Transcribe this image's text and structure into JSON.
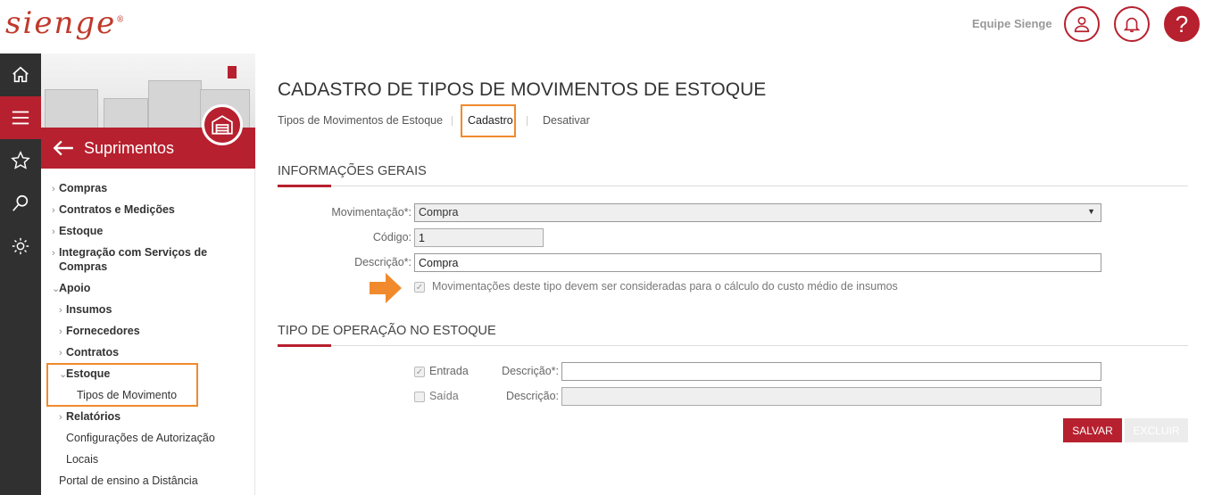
{
  "header": {
    "logo": "sienge",
    "logo_mark": "®",
    "team_label": "Equipe Sienge",
    "icons": [
      "user-icon",
      "bell-icon",
      "help-icon"
    ],
    "help_glyph": "?"
  },
  "rail": {
    "icons": [
      "home-icon",
      "menu-icon",
      "star-icon",
      "search-icon",
      "settings-icon"
    ]
  },
  "sidebar": {
    "module_title": "Suprimentos",
    "items": [
      {
        "label": "Compras"
      },
      {
        "label": "Contratos e Medições"
      },
      {
        "label": "Estoque"
      },
      {
        "label": "Integração com Serviços de"
      },
      {
        "label": "Compras"
      },
      {
        "label": "Apoio"
      },
      {
        "label": "Insumos"
      },
      {
        "label": "Fornecedores"
      },
      {
        "label": "Contratos"
      },
      {
        "label": "Estoque"
      },
      {
        "label": "Tipos de Movimento"
      },
      {
        "label": "Relatórios"
      },
      {
        "label": "Configurações de Autorização"
      },
      {
        "label": "Locais"
      },
      {
        "label": "Portal de ensino a Distância"
      }
    ]
  },
  "page": {
    "title": "CADASTRO DE TIPOS DE MOVIMENTOS DE ESTOQUE",
    "tabs": [
      "Tipos de Movimentos de Estoque",
      "Cadastro",
      "Desativar"
    ]
  },
  "general": {
    "section_title": "INFORMAÇÕES GERAIS",
    "movimentacao_label": "Movimentação*:",
    "movimentacao_value": "Compra",
    "codigo_label": "Código:",
    "codigo_value": "1",
    "descricao_label": "Descrição*:",
    "descricao_value": "Compra",
    "checkbox_label": "Movimentações deste tipo devem ser consideradas para o cálculo do custo médio de insumos",
    "checkbox_checked": true
  },
  "operation": {
    "section_title": "TIPO DE OPERAÇÃO NO ESTOQUE",
    "entrada_label": "Entrada",
    "entrada_checked": true,
    "entrada_desc_label": "Descrição*:",
    "entrada_desc_value": "",
    "saida_label": "Saída",
    "saida_checked": false,
    "saida_desc_label": "Descrição:",
    "saida_desc_value": ""
  },
  "actions": {
    "save_label": "SALVAR",
    "delete_label": "EXCLUIR"
  },
  "colors": {
    "brand": "#b7202e",
    "highlight": "#f08a2c",
    "rail": "#303030"
  }
}
